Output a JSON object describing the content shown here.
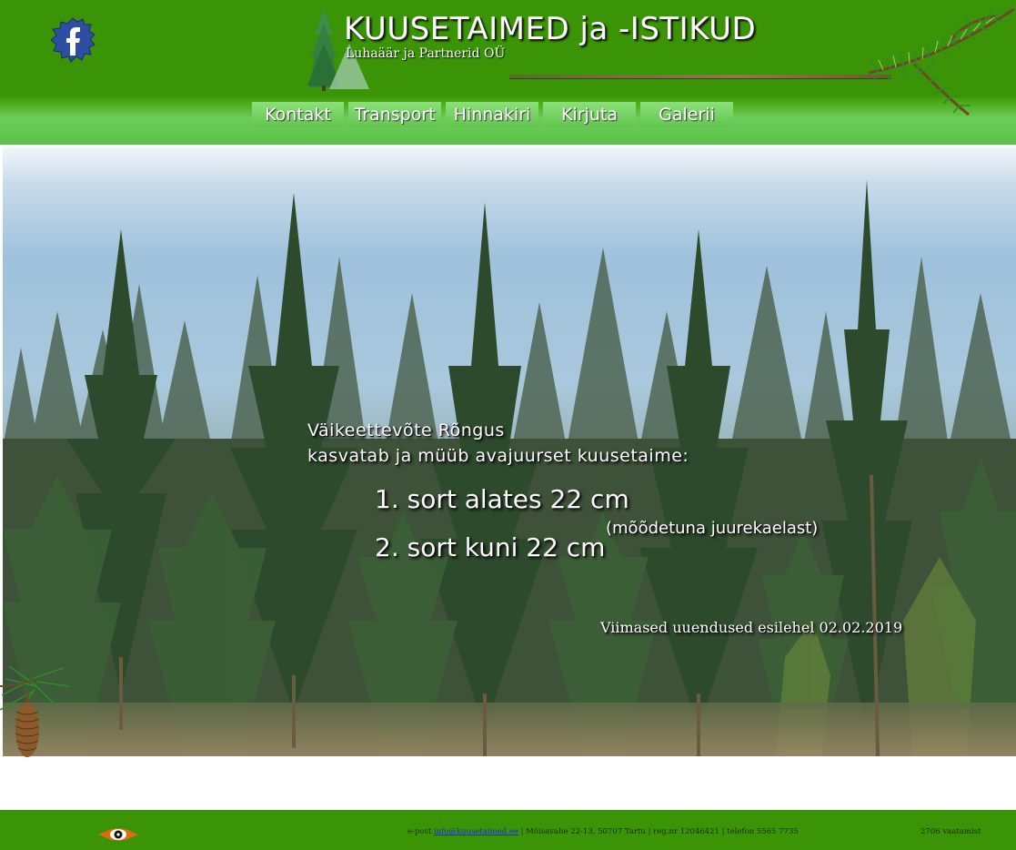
{
  "header": {
    "title": "KUUSETAIMED ja -ISTIKUD",
    "subtitle": "Luhaäär ja Partnerid OÜ"
  },
  "nav": {
    "items": [
      {
        "label": "Kontakt"
      },
      {
        "label": "Transport"
      },
      {
        "label": "Hinnakiri"
      },
      {
        "label": "Kirjuta"
      },
      {
        "label": "Galerii"
      }
    ]
  },
  "hero": {
    "intro_line1": "Väikeettevõte Rõngus",
    "intro_line2": "kasvatab ja müüb avajuurset kuusetaime:",
    "sort1": "1. sort alates 22 cm",
    "sort2": "2. sort kuni 22 cm",
    "measure_note": "(mõõdetuna juurekaelast)",
    "updated": "Viimased uuendused esilehel  02.02.2019"
  },
  "footer": {
    "email_prefix": "e-post ",
    "email": "info@kuusetaimed.ee",
    "contact_rest": " | Mõisavahe 22-13, 50707 Tartu | reg.nr 12046421 | telefon 5565 7735",
    "visits": "2706 vaatamist"
  },
  "colors": {
    "header_green": "#3a9405",
    "nav_green": "#62c54f",
    "footer_green": "#3a9405",
    "facebook_blue": "#2d4ea3"
  },
  "icons": {
    "facebook": "facebook-icon",
    "logo": "spruce-tree-logo-icon",
    "branch": "spruce-branch-icon",
    "cone": "spruce-cone-icon",
    "counter": "eye-icon"
  }
}
